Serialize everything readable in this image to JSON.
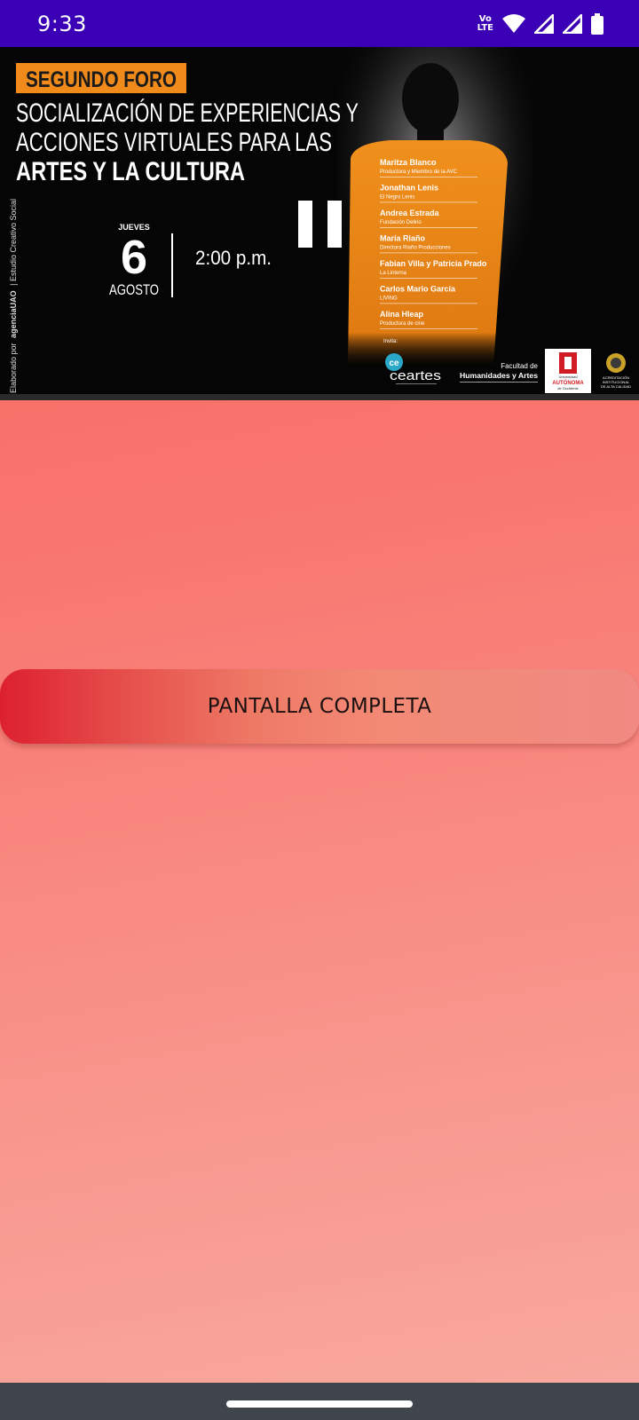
{
  "status_bar": {
    "time": "9:33",
    "volte_top": "Vo",
    "volte_bottom": "LTE",
    "icons": [
      "wifi-icon",
      "signal-icon",
      "signal-icon",
      "battery-icon"
    ]
  },
  "video": {
    "poster": {
      "badge": "SEGUNDO FORO",
      "title_line1": "SOCIALIZACIÓN DE EXPERIENCIAS Y",
      "title_line2": "ACCIONES  VIRTUALES PARA LAS",
      "title_line3": "ARTES Y LA CULTURA",
      "weekday": "JUEVES",
      "day": "6",
      "month": "AGOSTO",
      "time": "2:00 p.m.",
      "side_credit_prefix": "Elaborado por",
      "side_credit_brand": "agenciaUAO",
      "side_credit_suffix": "| Estudio Creativo Social",
      "speakers": [
        {
          "name": "Maritza Blanco",
          "role": "Productora y Miembro de la AVC"
        },
        {
          "name": "Jonathan Lenis",
          "role": "El Negro Lenis"
        },
        {
          "name": "Andrea Estrada",
          "role": "Fundación Delirio"
        },
        {
          "name": "María Riaño",
          "role": "Directora Riaño Producciones"
        },
        {
          "name": "Fabian Villa y Patricia Prado",
          "role": "La Linterna"
        },
        {
          "name": "Carlos Mario García",
          "role": "LIVING"
        },
        {
          "name": "Alina Hleap",
          "role": "Productora de cine"
        }
      ],
      "invite_label": "Invita:",
      "ceartes_logo": "ceartes",
      "faculty_line1": "Facultad de",
      "faculty_line2": "Humanidades y Artes",
      "uao_line1": "Universidad",
      "uao_line2": "AUTÓNOMA",
      "uao_line3": "de Occidente",
      "accreditation_line1": "ACREDITACIÓN",
      "accreditation_line2": "INSTITUCIONAL",
      "accreditation_line3": "DE ALTA CALIDAD"
    },
    "state": "playing"
  },
  "fullscreen_button": {
    "label": "PANTALLA COMPLETA"
  }
}
